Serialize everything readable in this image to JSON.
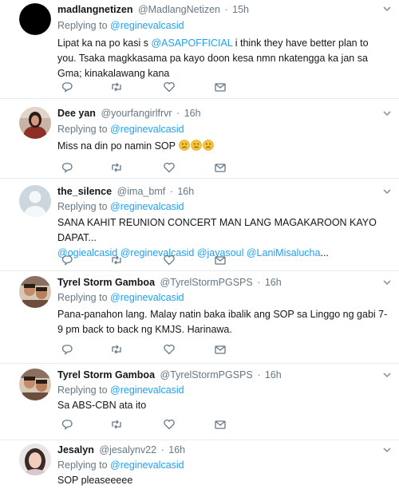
{
  "tweets": [
    {
      "name": "madlangnetizen",
      "handle": "@MadlangNetizen",
      "time": "15h",
      "replying_prefix": "Replying to",
      "replying_to": "@reginevalcasid",
      "text_parts": [
        "Lipat ka na po kasi s ",
        "@ASAPOFFICIAL",
        " i think they have better plan to you. Tsaka magkkasama pa kayo doon kesa nmn nkatengga ka jan sa Gma; kinakalawang kana"
      ],
      "avatar_icon": "black-circle-avatar"
    },
    {
      "name": "Dee yan",
      "handle": "@yourfangirlfrvr",
      "time": "16h",
      "replying_prefix": "Replying to",
      "replying_to": "@reginevalcasid",
      "text": "Miss na din po namin SOP",
      "emojis": [
        "frowning-face-icon",
        "frowning-face-icon",
        "frowning-face-icon"
      ],
      "avatar_icon": "woman-photo-avatar"
    },
    {
      "name": "the_silence",
      "handle": "@ima_bmf",
      "time": "16h",
      "replying_prefix": "Replying to",
      "replying_to": "@reginevalcasid",
      "text": "SANA KAHIT REUNION CONCERT MAN LANG MAGAKAROON KAYO DAPAT...",
      "mentions_line": [
        "@ogiealcasid",
        "@reginevalcasid",
        "@jayasoul",
        "@LaniMisalucha",
        "..."
      ],
      "avatar_icon": "default-profile-avatar"
    },
    {
      "name": "Tyrel Storm Gamboa",
      "handle": "@TyrelStormPGSPS",
      "time": "16h",
      "replying_prefix": "Replying to",
      "replying_to": "@reginevalcasid",
      "text": "Pana-panahon lang. Malay natin baka ibalik ang SOP sa Linggo ng gabi 7-9 pm back to back ng KMJS. Harinawa.",
      "avatar_icon": "group-photo-avatar"
    },
    {
      "name": "Tyrel Storm Gamboa",
      "handle": "@TyrelStormPGSPS",
      "time": "16h",
      "replying_prefix": "Replying to",
      "replying_to": "@reginevalcasid",
      "text": "Sa ABS-CBN ata ito",
      "avatar_icon": "group-photo-avatar"
    },
    {
      "name": "Jesalyn",
      "handle": "@jesalynv22",
      "time": "16h",
      "replying_prefix": "Replying to",
      "replying_to": "@reginevalcasid",
      "text": "SOP pleaseeeee",
      "avatar_icon": "woman-photo-avatar"
    }
  ],
  "actions": [
    "reply-icon",
    "retweet-icon",
    "like-icon",
    "direct-message-icon"
  ],
  "colors": {
    "link": "#1da1f2",
    "muted": "#657786",
    "text": "#14171a",
    "divider": "#e6ecf0"
  }
}
